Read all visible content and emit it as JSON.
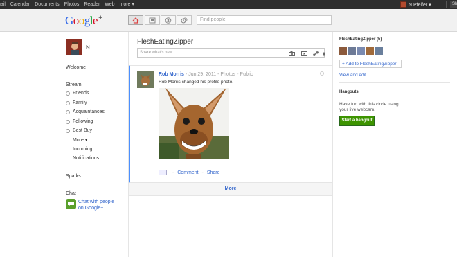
{
  "topbar": {
    "nav": [
      "nail",
      "Calendar",
      "Documents",
      "Photos",
      "Reader",
      "Web",
      "more ▾"
    ],
    "user_name": "N Pfeifer ▾",
    "share_label": "Sh"
  },
  "header": {
    "logo_text": "Google",
    "logo_plus": "+",
    "nav_icons": [
      "home-icon",
      "photos-icon",
      "profile-icon",
      "circles-icon"
    ],
    "search_placeholder": "Find people"
  },
  "left": {
    "profile_name": "N",
    "welcome": "Welcome",
    "stream_label": "Stream",
    "circles": [
      "Friends",
      "Family",
      "Acquaintances",
      "Following",
      "Best Buy"
    ],
    "more_label": "More ▾",
    "incoming": "Incoming",
    "notifications": "Notifications",
    "sparks": "Sparks",
    "chat_label": "Chat",
    "chat_link_line1": "Chat with people",
    "chat_link_line2": "on Google+"
  },
  "main": {
    "circle_title": "FleshEatingZipper",
    "share_placeholder": "Share what's new...",
    "post": {
      "author": "Rob Morris",
      "date": "Jun 29, 2011",
      "category": "Photos",
      "visibility": "Public",
      "caption": "Rob Morris changed his profile photo.",
      "actions": {
        "comment": "Comment",
        "share": "Share",
        "sep": "-"
      }
    },
    "more_label": "More"
  },
  "right": {
    "circle_title": "FleshEatingZipper (5)",
    "add_label": "+ Add to FleshEatingZipper",
    "view_edit": "View and edit",
    "hangouts_title": "Hangouts",
    "hangouts_text": "Have fun with this circle using your live webcam.",
    "hangout_button": "Start a hangout"
  },
  "colors": {
    "accent_link": "#3366cc",
    "hangout_green": "#3d9400",
    "top_bar": "#2d2d2d",
    "post_highlight": "#4d90fe"
  }
}
